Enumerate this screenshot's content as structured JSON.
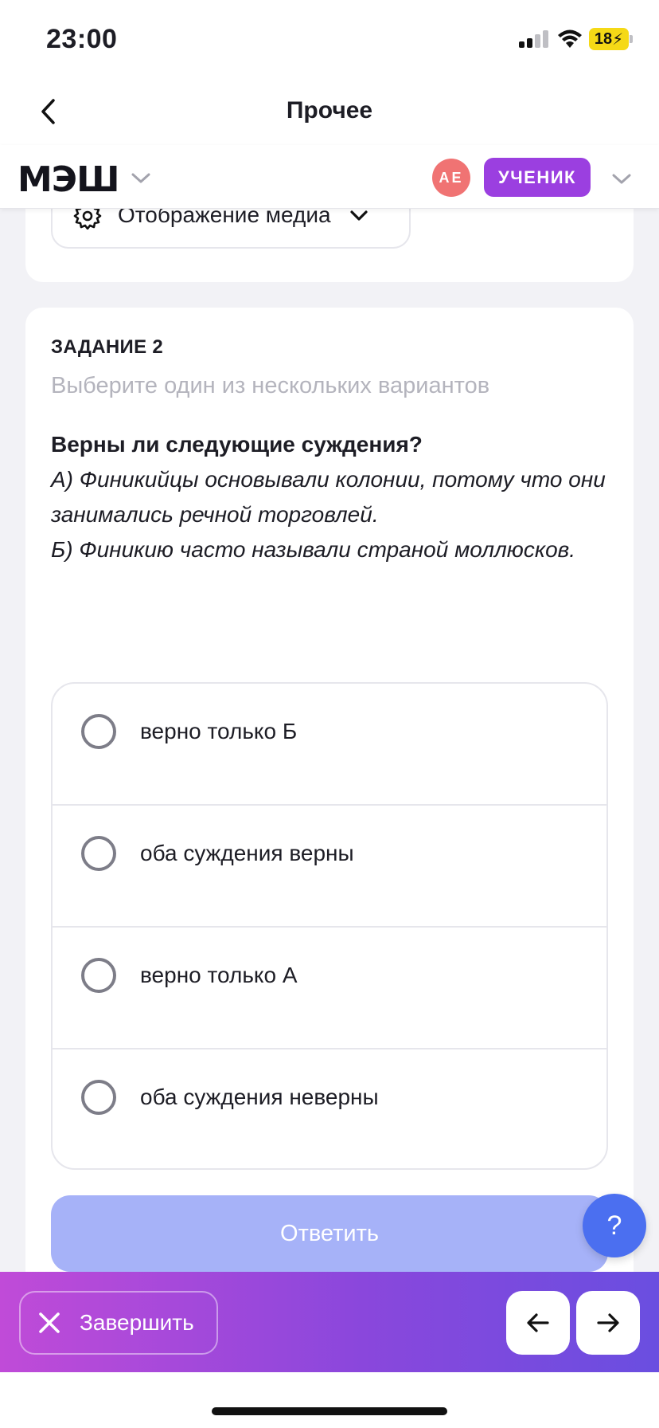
{
  "status_bar": {
    "time": "23:00",
    "battery": "18"
  },
  "nav": {
    "title": "Прочее"
  },
  "header": {
    "logo": "МЭШ",
    "avatar_initials": "АЕ",
    "role": "УЧЕНИК"
  },
  "media": {
    "label": "Отображение медиа"
  },
  "task": {
    "number": "ЗАДАНИЕ 2",
    "instruction": "Выберите один из нескольких вариантов",
    "question_title": "Верны ли следующие суждения?",
    "question_lines": [
      "А) Финикийцы основывали колонии, потому что они занимались речной торговлей.",
      "Б) Финикию часто называли страной моллюсков."
    ],
    "options": [
      {
        "label": "верно только Б",
        "selected": false
      },
      {
        "label": "оба суждения верны",
        "selected": false
      },
      {
        "label": "верно только А",
        "selected": false
      },
      {
        "label": "оба суждения неверны",
        "selected": false
      }
    ],
    "submit_label": "Ответить"
  },
  "help": {
    "label": "?"
  },
  "footer": {
    "finish_label": "Завершить"
  },
  "colors": {
    "accent_purple": "#9b3fe0",
    "avatar_red": "#f07373",
    "submit_disabled": "#a6b2f8",
    "help_blue": "#4b6ff0"
  }
}
